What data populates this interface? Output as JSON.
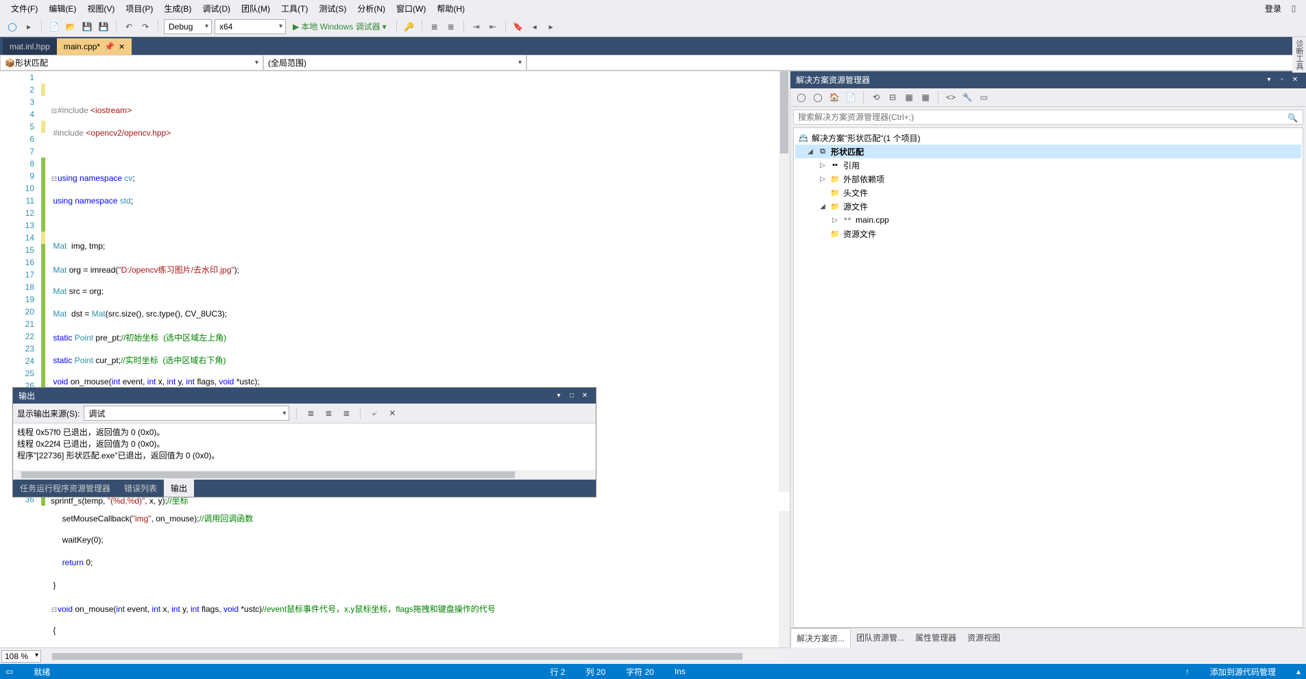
{
  "menu": {
    "file": "文件(F)",
    "edit": "编辑(E)",
    "view": "视图(V)",
    "project": "项目(P)",
    "build": "生成(B)",
    "debug": "调试(D)",
    "team": "团队(M)",
    "tools": "工具(T)",
    "test": "测试(S)",
    "analyze": "分析(N)",
    "window": "窗口(W)",
    "help": "帮助(H)",
    "login": "登录"
  },
  "toolbar": {
    "config": "Debug",
    "platform": "x64",
    "debugger": "本地 Windows 调试器"
  },
  "tabs": {
    "t1": "mat.inl.hpp",
    "t2": "main.cpp*"
  },
  "nav": {
    "scope": "形状匹配",
    "func": "(全局范围)"
  },
  "zoom": "108 %",
  "editor": {
    "last_line_num": "36",
    "last_line_text": "        sprintf_s(temp, \"(%d,%d)\", x, y);//坐标"
  },
  "output": {
    "title": "输出",
    "source_label": "显示输出来源(S):",
    "source": "调试",
    "l1": "线程 0x57f0 已退出，返回值为 0 (0x0)。",
    "l2": "线程 0x22f4 已退出，返回值为 0 (0x0)。",
    "l3": "程序\"[22736] 形状匹配.exe\"已退出，返回值为 0 (0x0)。",
    "tab1": "任务运行程序资源管理器",
    "tab2": "错误列表",
    "tab3": "输出"
  },
  "solution": {
    "title": "解决方案资源管理器",
    "search_ph": "搜索解决方案资源管理器(Ctrl+;)",
    "root": "解决方案\"形状匹配\"(1 个项目)",
    "proj": "形状匹配",
    "refs": "引用",
    "ext": "外部依赖项",
    "hdr": "头文件",
    "src": "源文件",
    "main": "main.cpp",
    "res": "资源文件",
    "bt1": "解决方案资...",
    "bt2": "团队资源管...",
    "bt3": "属性管理器",
    "bt4": "资源视图"
  },
  "status": {
    "ready": "就绪",
    "row": "行 2",
    "col": "列 20",
    "char": "字符 20",
    "ins": "Ins",
    "scm": "添加到源代码管理"
  },
  "rightrail": "诊断工具"
}
